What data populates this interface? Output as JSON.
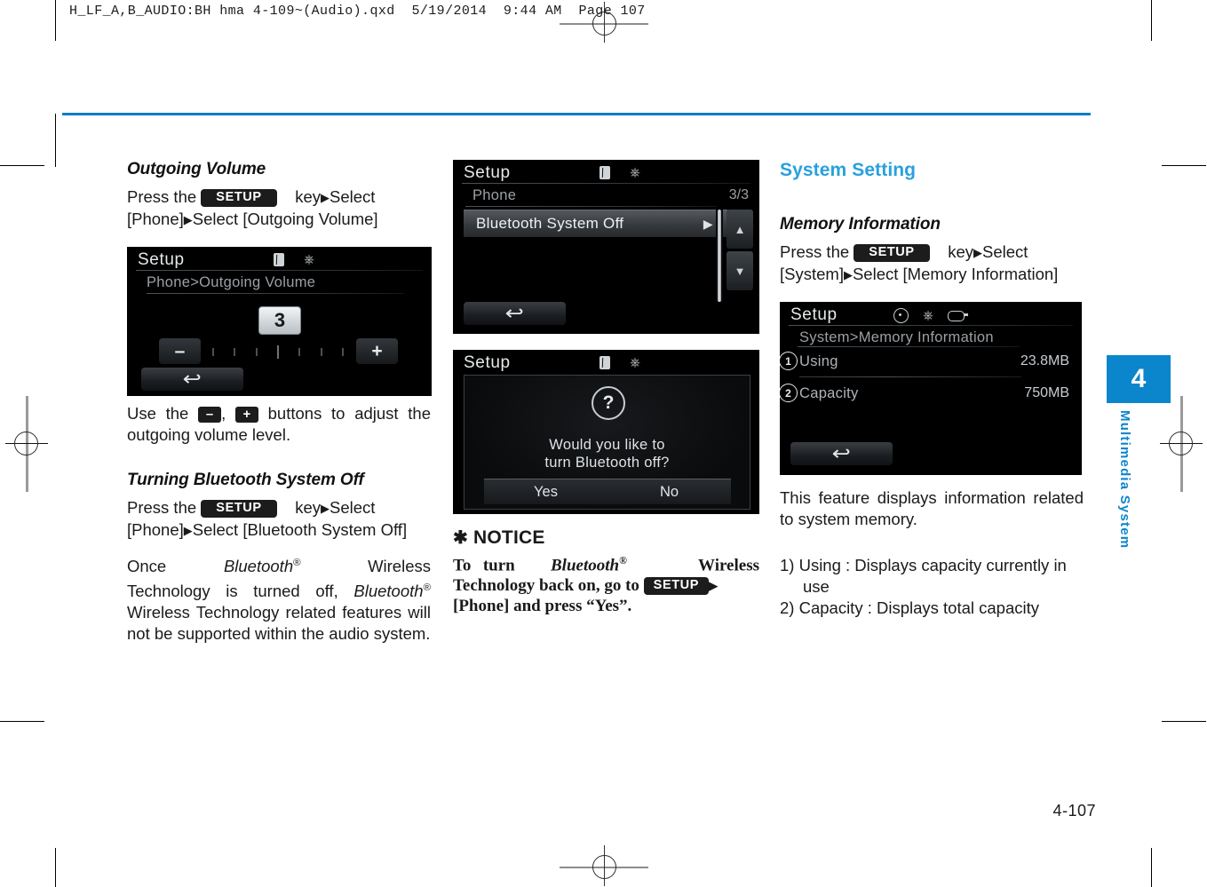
{
  "print": {
    "file_slug": "H_LF_A,B_AUDIO:BH hma 4-109~(Audio).qxd  5/19/2014  9:44 AM  Page 107"
  },
  "chapter_tab": {
    "number": "4",
    "label": "Multimedia System"
  },
  "page_number": "4-107",
  "columns": {
    "left": {
      "outgoing_volume": {
        "heading": "Outgoing Volume",
        "instruction_pre": "Press    the",
        "setup_key": "SETUP",
        "instruction_post": "key",
        "instruction_line1_tail": "Select",
        "instruction_line2": "[Phone]",
        "instruction_line2_tail": "Select [Outgoing Volume]"
      },
      "volume_screen": {
        "title": "Setup",
        "breadcrumb": "Phone>Outgoing Volume",
        "value": "3",
        "minus": "–",
        "plus": "+",
        "back_icon": "back-arrow-icon",
        "bt_icon": "bluetooth-icon",
        "usb_icon": "usb-icon"
      },
      "adjust_text_pre": "Use the",
      "adjust_minus": "–",
      "adjust_comma": ",",
      "adjust_plus": "+",
      "adjust_text_post": "buttons to adjust the outgoing volume level.",
      "bluetooth_off": {
        "heading": "Turning Bluetooth System Off",
        "instruction_pre": "Press    the",
        "setup_key": "SETUP",
        "instruction_post": "key",
        "instruction_line1_tail": "Select",
        "instruction_line2": "[Phone]",
        "instruction_line2_tail": "Select  [Bluetooth  System Off]",
        "para_once": "Once",
        "para_bt1": "Bluetooth",
        "para_reg1": "®",
        "para_wireless": "Wireless Technology is turned off,",
        "para_bt2": "Bluetooth",
        "para_reg2": "®",
        "para_tail": "Wireless Technology related features will not be supported within the audio system."
      }
    },
    "middle": {
      "list_screen": {
        "title": "Setup",
        "breadcrumb": "Phone",
        "page_indicator": "3/3",
        "row_label": "Bluetooth System Off",
        "row_caret": "▶",
        "scroll_up": "▲",
        "scroll_down": "▼",
        "back_icon": "back-arrow-icon"
      },
      "dialog_screen": {
        "title": "Setup",
        "question_mark": "?",
        "message_line1": "Would you like to",
        "message_line2": "turn Bluetooth off?",
        "yes": "Yes",
        "no": "No"
      },
      "notice": {
        "asterisk": "✱",
        "heading": "NOTICE",
        "line_a": "To   turn",
        "bt": "Bluetooth",
        "reg": "®",
        "wireless": "Wireless",
        "line_b": "Technology  back  on,  go  to",
        "setup_key": "SETUP",
        "line_c": "[Phone] and press “Yes”."
      }
    },
    "right": {
      "section_title": "System Setting",
      "memory_information": {
        "heading": "Memory Information",
        "instruction_pre": "Press    the",
        "setup_key": "SETUP",
        "instruction_post": "key",
        "instruction_line1_tail": "Select",
        "instruction_line2": "[System]",
        "instruction_line2_tail": "Select [Memory Information]"
      },
      "memory_screen": {
        "title": "Setup",
        "breadcrumb": "System>Memory Information",
        "rows": [
          {
            "num": "1",
            "label": "Using",
            "value": "23.8MB"
          },
          {
            "num": "2",
            "label": "Capacity",
            "value": "750MB"
          }
        ],
        "back_icon": "back-arrow-icon",
        "disc_icon": "disc-icon",
        "usb_icon": "usb-icon",
        "aux_icon": "aux-icon"
      },
      "description": "This feature displays information related to system memory.",
      "list_items": [
        "1) Using : Displays capacity currently in use",
        "2) Capacity : Displays total capacity"
      ]
    }
  },
  "colors": {
    "accent_blue": "#29a0dd",
    "rule_blue": "#0b7dc4",
    "tab_blue": "#0b86cd"
  }
}
